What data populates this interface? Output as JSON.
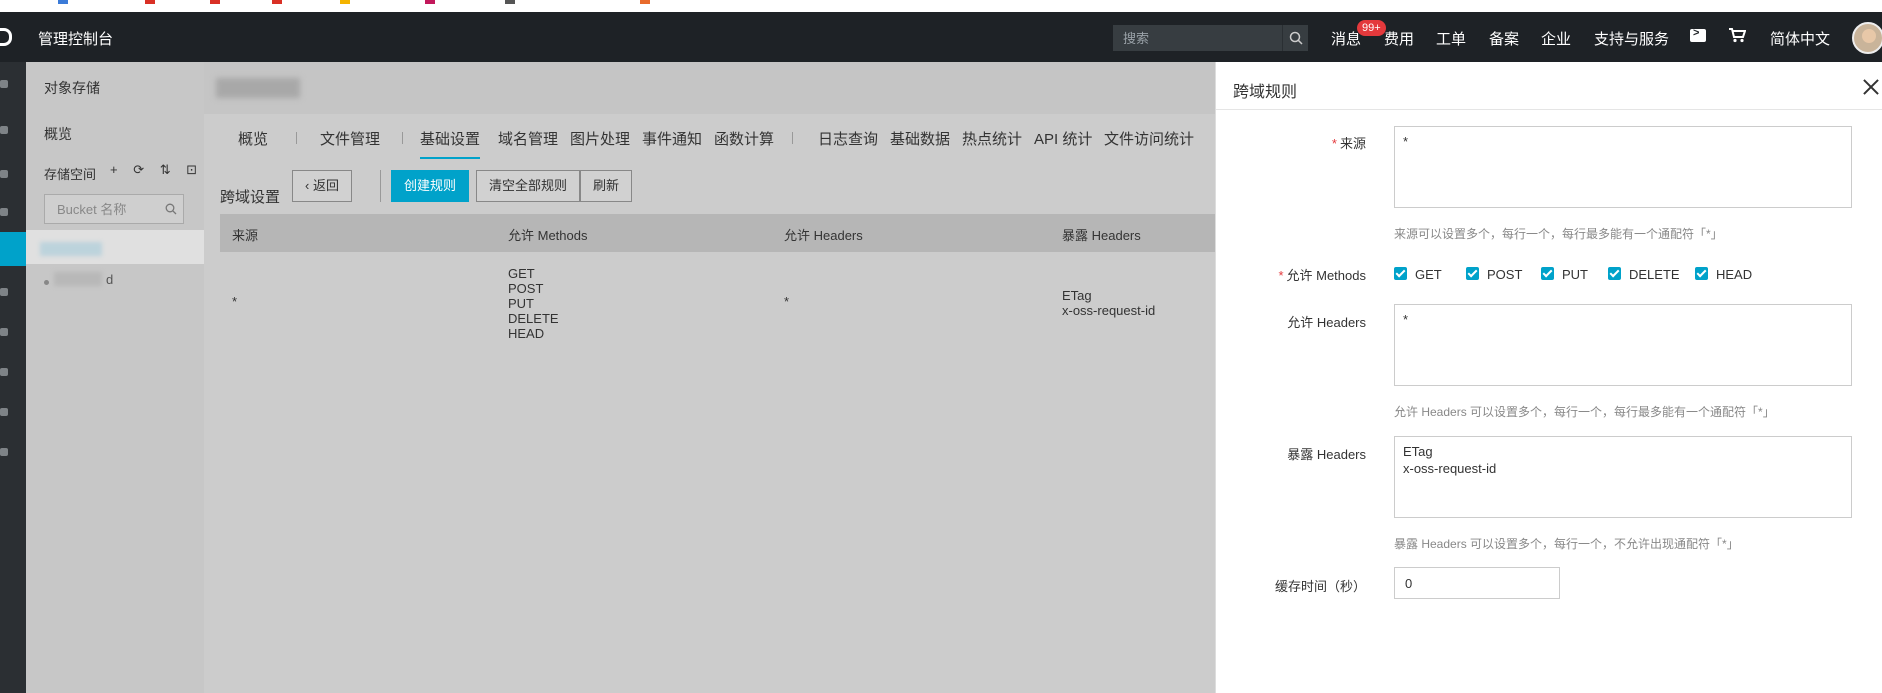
{
  "topnav": {
    "console": "管理控制台",
    "search_placeholder": "搜索",
    "messages": "消息",
    "messages_badge": "99+",
    "billing": "费用",
    "tickets": "工单",
    "filing": "备案",
    "enterprise": "企业",
    "support": "支持与服务",
    "language": "简体中文"
  },
  "sidebar": {
    "title": "对象存储",
    "overview": "概览",
    "bucket_label": "存储空间",
    "tools": "+ ⟳ ⇅ ⊡",
    "bucket_search_placeholder": "Bucket 名称",
    "bucket2_suffix": "d"
  },
  "tabs": [
    "概览",
    "文件管理",
    "基础设置",
    "域名管理",
    "图片处理",
    "事件通知",
    "函数计算",
    "日志查询",
    "基础数据",
    "热点统计",
    "API 统计",
    "文件访问统计"
  ],
  "toolbar": {
    "label": "跨域设置",
    "back": "返回",
    "create": "创建规则",
    "clear": "清空全部规则",
    "refresh": "刷新"
  },
  "table": {
    "headers": [
      "来源",
      "允许 Methods",
      "允许 Headers",
      "暴露 Headers"
    ],
    "row": {
      "origin": "*",
      "methods": "GET\nPOST\nPUT\nDELETE\nHEAD",
      "allow_headers": "*",
      "expose_headers": "ETag\nx-oss-request-id"
    }
  },
  "drawer": {
    "title": "跨域规则",
    "origin_label": "来源",
    "origin_value": "*",
    "origin_hint": "来源可以设置多个，每行一个，每行最多能有一个通配符「*」",
    "methods_label": "允许 Methods",
    "methods": [
      "GET",
      "POST",
      "PUT",
      "DELETE",
      "HEAD"
    ],
    "allow_headers_label": "允许 Headers",
    "allow_headers_value": "*",
    "allow_headers_hint": "允许 Headers 可以设置多个，每行一个，每行最多能有一个通配符「*」",
    "expose_headers_label": "暴露 Headers",
    "expose_headers_value": "ETag\nx-oss-request-id",
    "expose_headers_hint": "暴露 Headers 可以设置多个，每行一个，不允许出现通配符「*」",
    "cache_label": "缓存时间（秒）",
    "cache_value": "0"
  },
  "colors": {
    "accent": "#00a2ca",
    "topbar": "#1e2226",
    "required": "#e4393c"
  }
}
